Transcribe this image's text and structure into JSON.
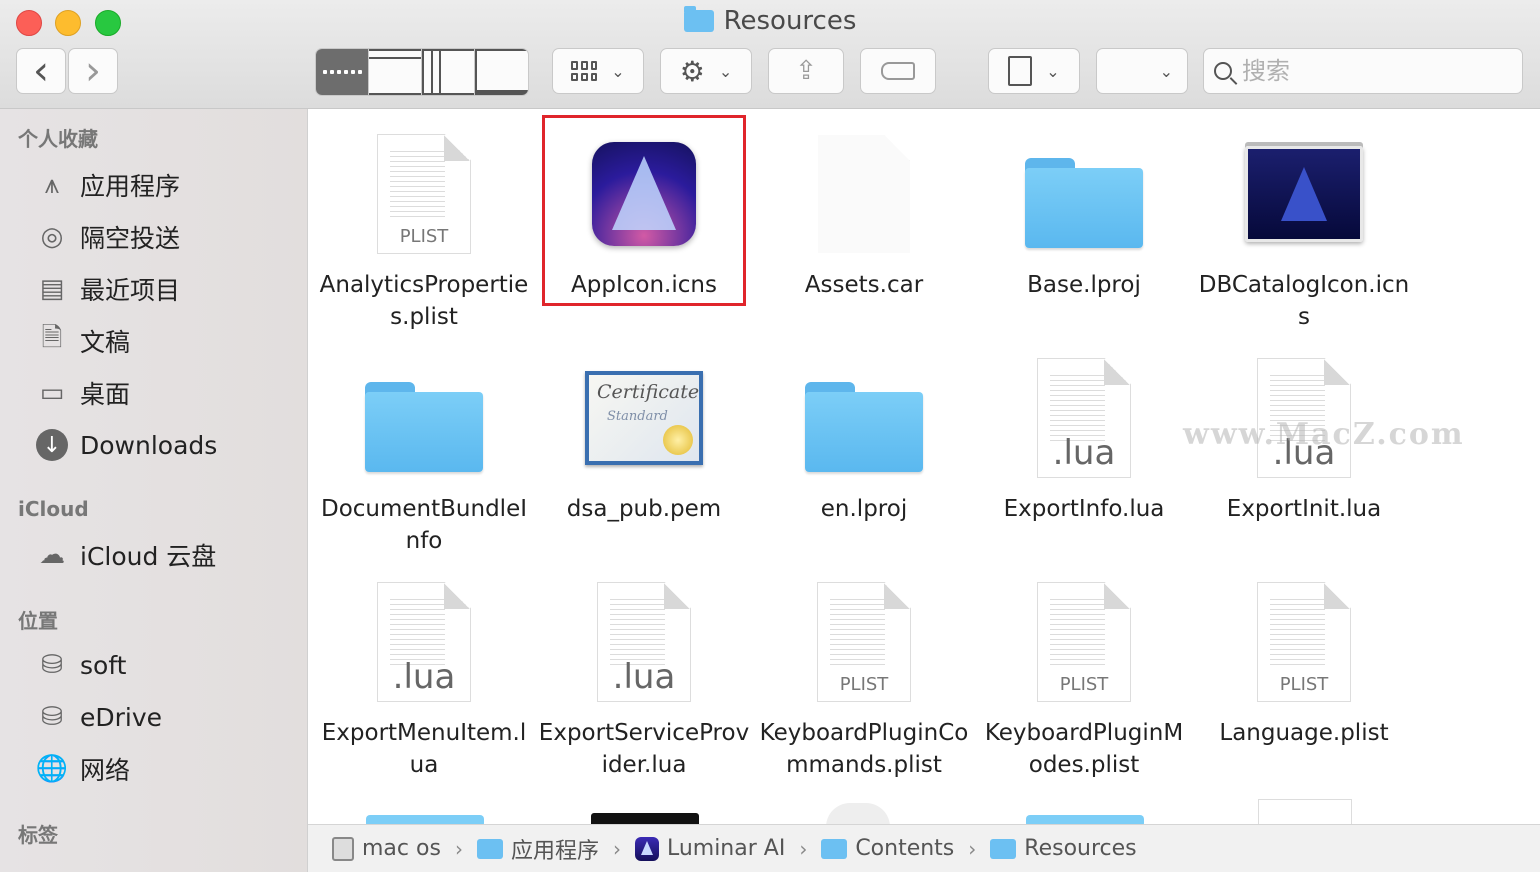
{
  "window": {
    "title": "Resources"
  },
  "toolbar": {
    "back": "‹",
    "forward": "›",
    "search_placeholder": "搜索"
  },
  "sidebar": {
    "sections": [
      {
        "heading": "个人收藏",
        "items": [
          {
            "label": "应用程序",
            "icon": "applications-icon"
          },
          {
            "label": "隔空投送",
            "icon": "airdrop-icon"
          },
          {
            "label": "最近项目",
            "icon": "recents-icon"
          },
          {
            "label": "文稿",
            "icon": "documents-icon"
          },
          {
            "label": "桌面",
            "icon": "desktop-icon"
          },
          {
            "label": "Downloads",
            "icon": "downloads-icon"
          }
        ]
      },
      {
        "heading": "iCloud",
        "items": [
          {
            "label": "iCloud 云盘",
            "icon": "cloud-icon"
          }
        ]
      },
      {
        "heading": "位置",
        "items": [
          {
            "label": "soft",
            "icon": "disk-icon"
          },
          {
            "label": "eDrive",
            "icon": "disk-icon"
          },
          {
            "label": "网络",
            "icon": "network-icon"
          }
        ]
      },
      {
        "heading": "标签",
        "items": []
      }
    ]
  },
  "files": [
    {
      "name": "AnalyticsProperties.plist",
      "kind": "plist",
      "ext": "PLIST"
    },
    {
      "name": "AppIcon.icns",
      "kind": "appicon",
      "selected": true
    },
    {
      "name": "Assets.car",
      "kind": "blank"
    },
    {
      "name": "Base.lproj",
      "kind": "folder"
    },
    {
      "name": "DBCatalogIcon.icns",
      "kind": "dbicon"
    },
    {
      "name": "DocumentBundleInfo",
      "kind": "folder"
    },
    {
      "name": "dsa_pub.pem",
      "kind": "cert",
      "cert_line1": "Certificate",
      "cert_line2": "Standard"
    },
    {
      "name": "en.lproj",
      "kind": "folder"
    },
    {
      "name": "ExportInfo.lua",
      "kind": "lua",
      "ext": ".lua"
    },
    {
      "name": "ExportInit.lua",
      "kind": "lua",
      "ext": ".lua"
    },
    {
      "name": "ExportMenuItem.lua",
      "kind": "lua",
      "ext": ".lua"
    },
    {
      "name": "ExportServiceProvider.lua",
      "kind": "lua",
      "ext": ".lua"
    },
    {
      "name": "KeyboardPluginCommands.plist",
      "kind": "plist",
      "ext": "PLIST"
    },
    {
      "name": "KeyboardPluginModes.plist",
      "kind": "plist",
      "ext": "PLIST"
    },
    {
      "name": "Language.plist",
      "kind": "plist",
      "ext": "PLIST"
    }
  ],
  "watermark": "www.MacZ.com",
  "pathbar": [
    {
      "label": "mac os",
      "icon": "disk-icon"
    },
    {
      "label": "应用程序",
      "icon": "folder-icon"
    },
    {
      "label": "Luminar AI",
      "icon": "luminar-icon"
    },
    {
      "label": "Contents",
      "icon": "folder-icon"
    },
    {
      "label": "Resources",
      "icon": "folder-icon"
    }
  ]
}
